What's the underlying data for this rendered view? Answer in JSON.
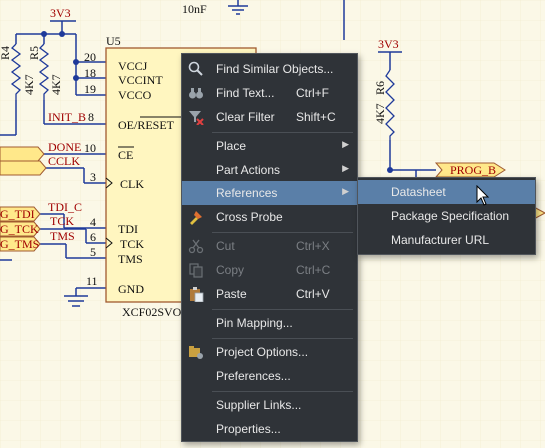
{
  "schematic": {
    "power_labels": [
      "3V3",
      "3V3"
    ],
    "cap_label": "10nF",
    "chip": {
      "designator": "U5",
      "part": "XCF02SVO",
      "left_pins": [
        {
          "name": "OE/RESET",
          "num": "8"
        },
        {
          "name": "CE",
          "num": "10"
        },
        {
          "name": "CLK",
          "num": "3"
        },
        {
          "name": "TDI",
          "num": "4"
        },
        {
          "name": "TCK",
          "num": "6"
        },
        {
          "name": "TMS",
          "num": "5"
        },
        {
          "name": "GND",
          "num": "11"
        }
      ],
      "top_pins": [
        {
          "name": "VCCJ",
          "num": "20"
        },
        {
          "name": "VCCINT",
          "num": "18"
        },
        {
          "name": "VCCO",
          "num": "19"
        }
      ]
    },
    "resistors": [
      {
        "ref": "R4",
        "value": "4K7"
      },
      {
        "ref": "R5",
        "value": "4K7"
      },
      {
        "ref": "R6",
        "value": "4K7"
      }
    ],
    "nets": [
      "INIT_B",
      "DONE",
      "CCLK",
      "TDI_C",
      "TCK",
      "TMS"
    ],
    "ports": [
      "PROG_B",
      "G_TDI",
      "G_TCK",
      "G_TMS"
    ]
  },
  "context_menu": {
    "items": [
      {
        "label": "Find Similar Objects...",
        "shortcut": "",
        "icon": "find-similar-icon"
      },
      {
        "label": "Find Text...",
        "shortcut": "Ctrl+F",
        "icon": "binoculars-icon"
      },
      {
        "label": "Clear Filter",
        "shortcut": "Shift+C",
        "icon": "clear-filter-icon"
      },
      {
        "label": "Place",
        "shortcut": "",
        "submenu": true
      },
      {
        "label": "Part Actions",
        "shortcut": "",
        "submenu": true
      },
      {
        "label": "References",
        "shortcut": "",
        "submenu": true,
        "highlighted": true
      },
      {
        "label": "Cross Probe",
        "shortcut": "",
        "icon": "cross-probe-icon"
      },
      {
        "label": "Cut",
        "shortcut": "Ctrl+X",
        "icon": "scissors-icon",
        "disabled": true
      },
      {
        "label": "Copy",
        "shortcut": "Ctrl+C",
        "icon": "copy-icon",
        "disabled": true
      },
      {
        "label": "Paste",
        "shortcut": "Ctrl+V",
        "icon": "paste-icon"
      },
      {
        "label": "Pin Mapping...",
        "shortcut": ""
      },
      {
        "label": "Project Options...",
        "shortcut": "",
        "icon": "project-options-icon"
      },
      {
        "label": "Preferences...",
        "shortcut": ""
      },
      {
        "label": "Supplier Links...",
        "shortcut": ""
      },
      {
        "label": "Properties...",
        "shortcut": ""
      }
    ]
  },
  "references_submenu": {
    "items": [
      {
        "label": "Datasheet",
        "highlighted": true
      },
      {
        "label": "Package Specification"
      },
      {
        "label": "Manufacturer URL"
      }
    ]
  },
  "colors": {
    "sheet": "#fbf8e7",
    "wire": "#1f3a9a",
    "component_fill": "#fff6c0",
    "component_border": "#a05a30",
    "menu_bg": "#2f3338",
    "menu_highlight": "#5a7fa8",
    "port_fill": "#ffe88a"
  }
}
